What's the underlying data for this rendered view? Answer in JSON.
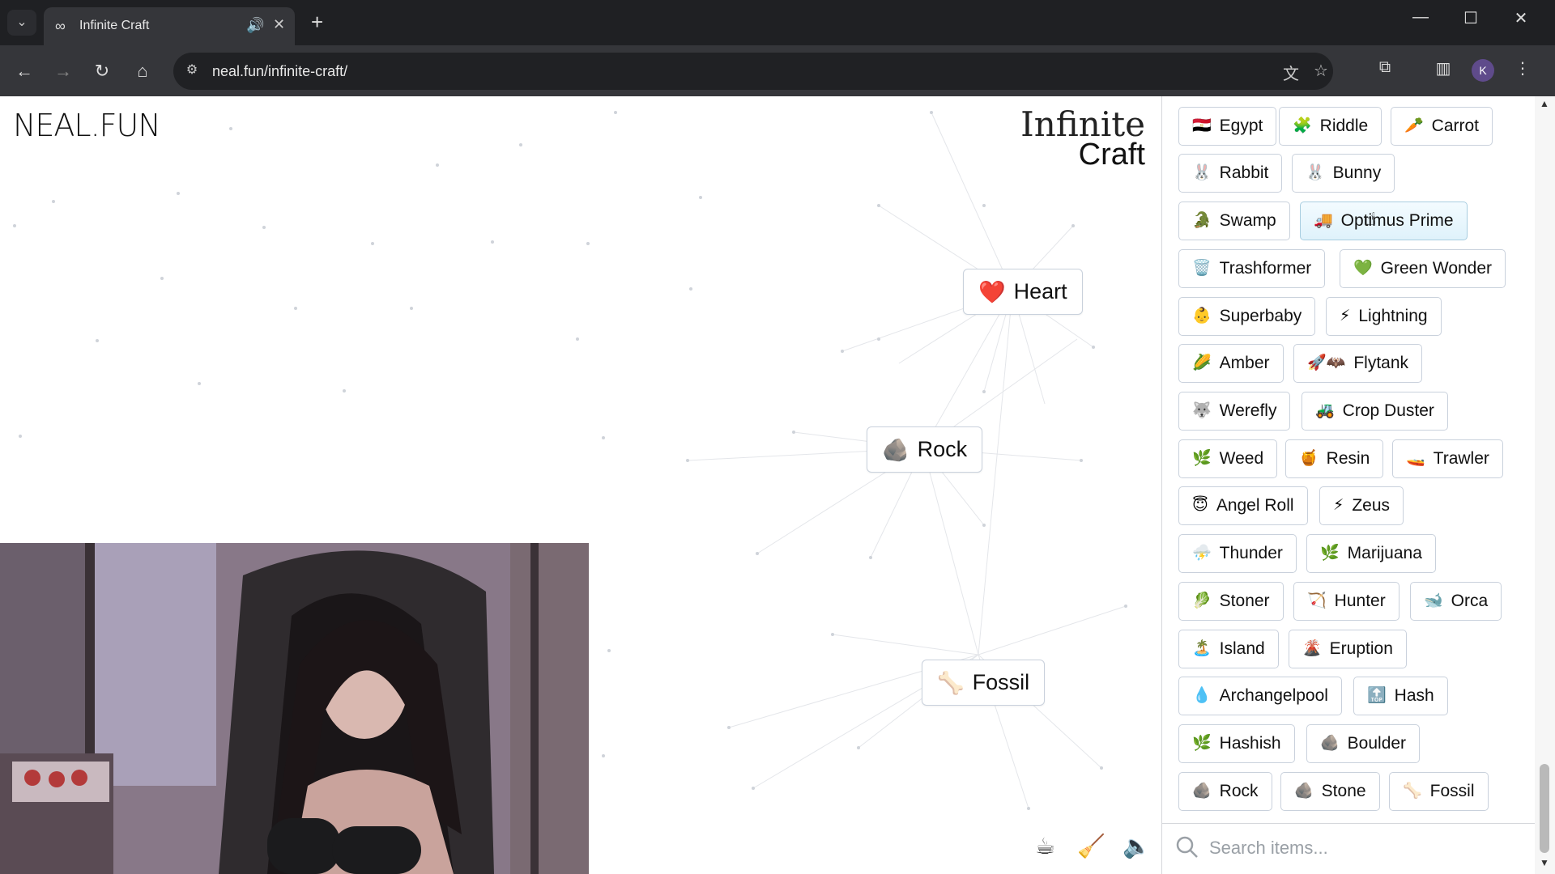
{
  "browser": {
    "tab_title": "Infinite Craft",
    "url": "neal.fun/infinite-craft/",
    "profile_initial": "K",
    "icons": {
      "tab_search": "chevron-down-icon",
      "tab_favicon": "infinity-icon",
      "tab_audio": "speaker-icon",
      "tab_close": "close-icon",
      "new_tab": "plus-icon",
      "minimize": "minimize-icon",
      "maximize": "maximize-icon",
      "close_window": "close-icon",
      "back": "arrow-left-icon",
      "forward": "arrow-right-icon",
      "reload": "reload-icon",
      "home": "home-icon",
      "site_info": "tune-icon",
      "translate": "translate-icon",
      "bookmark": "star-icon",
      "extensions": "puzzle-icon",
      "side_panel": "side-panel-icon",
      "menu": "kebab-menu-icon"
    }
  },
  "page": {
    "logo": "NEAL.FUN",
    "title_line1": "Infinite",
    "title_line2": "Craft"
  },
  "canvas_nodes": [
    {
      "emoji": "❤️",
      "label": "Heart"
    },
    {
      "emoji": "🪨",
      "label": "Rock"
    },
    {
      "emoji": "🦴",
      "label": "Fossil"
    }
  ],
  "bottom_tools": [
    "coffee-cup-icon",
    "broom-icon",
    "speaker-icon"
  ],
  "sidebar": {
    "items": [
      {
        "emoji": "🇪🇬",
        "label": "Egypt"
      },
      {
        "emoji": "🧩",
        "label": "Riddle"
      },
      {
        "emoji": "🥕",
        "label": "Carrot"
      },
      {
        "emoji": "🐰",
        "label": "Rabbit"
      },
      {
        "emoji": "🐰",
        "label": "Bunny"
      },
      {
        "emoji": "🐊",
        "label": "Swamp"
      },
      {
        "emoji": "🚚",
        "label": "Optimus Prime"
      },
      {
        "emoji": "🗑️",
        "label": "Trashformer"
      },
      {
        "emoji": "💚",
        "label": "Green Wonder"
      },
      {
        "emoji": "👶",
        "label": "Superbaby"
      },
      {
        "emoji": "⚡",
        "label": "Lightning"
      },
      {
        "emoji": "🌽",
        "label": "Amber"
      },
      {
        "emoji": "🚀🦇",
        "label": "Flytank"
      },
      {
        "emoji": "🐺",
        "label": "Werefly"
      },
      {
        "emoji": "🚜",
        "label": "Crop Duster"
      },
      {
        "emoji": "🌿",
        "label": "Weed"
      },
      {
        "emoji": "🍯",
        "label": "Resin"
      },
      {
        "emoji": "🚤",
        "label": "Trawler"
      },
      {
        "emoji": "😇",
        "label": "Angel Roll"
      },
      {
        "emoji": "⚡",
        "label": "Zeus"
      },
      {
        "emoji": "⛈️",
        "label": "Thunder"
      },
      {
        "emoji": "🌿",
        "label": "Marijuana"
      },
      {
        "emoji": "🥬",
        "label": "Stoner"
      },
      {
        "emoji": "🏹",
        "label": "Hunter"
      },
      {
        "emoji": "🐋",
        "label": "Orca"
      },
      {
        "emoji": "🏝️",
        "label": "Island"
      },
      {
        "emoji": "🌋",
        "label": "Eruption"
      },
      {
        "emoji": "💧",
        "label": "Archangelpool"
      },
      {
        "emoji": "🔝",
        "label": "Hash"
      },
      {
        "emoji": "🌿",
        "label": "Hashish"
      },
      {
        "emoji": "🪨",
        "label": "Boulder"
      },
      {
        "emoji": "🪨",
        "label": "Rock"
      },
      {
        "emoji": "🪨",
        "label": "Stone"
      },
      {
        "emoji": "🦴",
        "label": "Fossil"
      }
    ],
    "hovered_item": "Optimus Prime",
    "search_placeholder": "Search items..."
  }
}
